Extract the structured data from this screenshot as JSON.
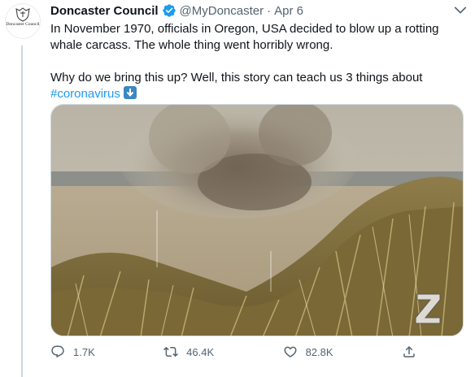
{
  "tweet": {
    "author_name": "Doncaster Council",
    "handle": "@MyDoncaster",
    "separator": "·",
    "date": "Apr 6",
    "avatar_text": "Doncaster Council",
    "text_line1": "In November 1970, officials in Oregon, USA decided to blow up a rotting whale carcass. The whole thing went horribly wrong.",
    "text_line2": "Why do we bring this up? Well, this story can teach us 3 things about",
    "hashtag": "#coronavirus",
    "emoji": "down-arrow-emoji"
  },
  "actions": {
    "replies": "1.7K",
    "retweets": "46.4K",
    "likes": "82.8K"
  },
  "icons": {
    "reply": "reply-icon",
    "retweet": "retweet-icon",
    "like": "heart-icon",
    "share": "share-icon",
    "verified": "verified-badge-icon",
    "more": "more-icon"
  },
  "colors": {
    "accent": "#1d9bf0",
    "secondary_text": "#536471"
  }
}
